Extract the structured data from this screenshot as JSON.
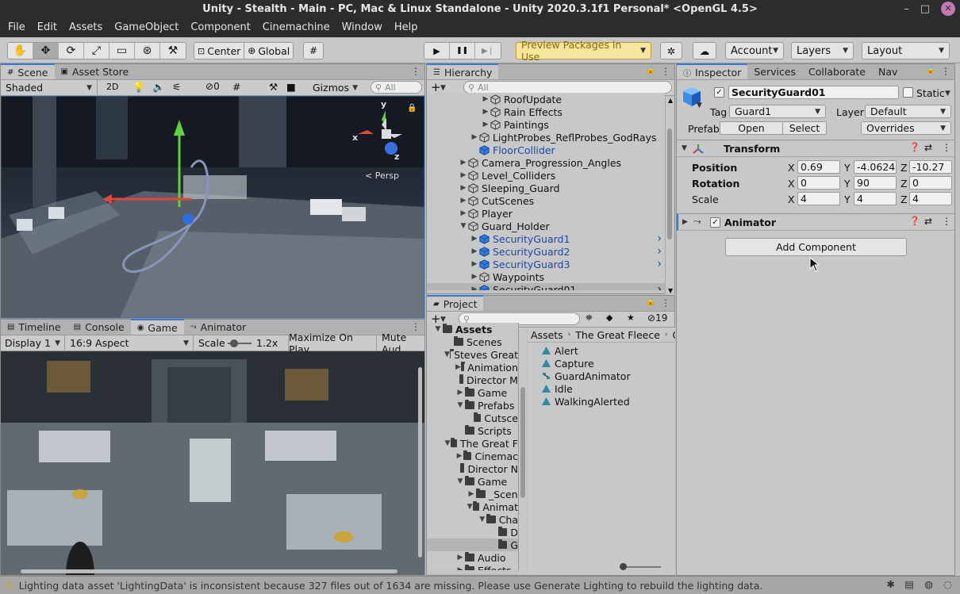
{
  "window": {
    "title": "Unity - Stealth - Main - PC, Mac & Linux Standalone - Unity 2020.3.1f1 Personal* <OpenGL 4.5>",
    "minimize": "–",
    "maximize": "□",
    "close": "✕"
  },
  "menu": [
    "File",
    "Edit",
    "Assets",
    "GameObject",
    "Component",
    "Cinemachine",
    "Window",
    "Help"
  ],
  "toolbar": {
    "tools": [
      "✋",
      "✥",
      "⟳",
      "⤢",
      "▭",
      "⊛",
      "⚒"
    ],
    "center_label": "Center",
    "global_label": "Global",
    "play": "▶",
    "pause": "❚❚",
    "step": "▶❘",
    "preview_packages": "Preview Packages in Use",
    "account_label": "Account",
    "layers_label": "Layers",
    "layout_label": "Layout"
  },
  "scene": {
    "tab_scene": "Scene",
    "tab_asset_store": "Asset Store",
    "shading": "Shaded",
    "mode_2d": "2D",
    "hidden_count": "0",
    "gizmos": "Gizmos",
    "search_placeholder": "All",
    "persp_label": "< Persp",
    "axis_x": "x",
    "axis_y": "y",
    "axis_z": "z"
  },
  "game": {
    "tabs": [
      "Timeline",
      "Console",
      "Game",
      "Animator"
    ],
    "display": "Display 1",
    "aspect": "16:9 Aspect",
    "scale_label": "Scale",
    "scale_value": "1.2x",
    "maximize_on_play": "Maximize On Play",
    "mute_audio": "Mute Aud"
  },
  "hierarchy": {
    "tab": "Hierarchy",
    "search_placeholder": "All",
    "add": "+",
    "rows": [
      {
        "label": "RoofUpdate",
        "indent": 3,
        "arrow": "▶",
        "icon": "gameobject",
        "blue": false,
        "selected": false,
        "chevron": false
      },
      {
        "label": "Rain Effects",
        "indent": 3,
        "arrow": "▶",
        "icon": "gameobject",
        "blue": false,
        "selected": false,
        "chevron": false
      },
      {
        "label": "Paintings",
        "indent": 3,
        "arrow": "▶",
        "icon": "gameobject",
        "blue": false,
        "selected": false,
        "chevron": false
      },
      {
        "label": "LightProbes_ReflProbes_GodRays",
        "indent": 2,
        "arrow": "▶",
        "icon": "gameobject",
        "blue": false,
        "selected": false,
        "chevron": false
      },
      {
        "label": "FloorCollider",
        "indent": 2,
        "arrow": "",
        "icon": "prefab",
        "blue": true,
        "selected": false,
        "chevron": false
      },
      {
        "label": "Camera_Progression_Angles",
        "indent": 1,
        "arrow": "▶",
        "icon": "gameobject",
        "blue": false,
        "selected": false,
        "chevron": false
      },
      {
        "label": "Level_Colliders",
        "indent": 1,
        "arrow": "▶",
        "icon": "gameobject",
        "blue": false,
        "selected": false,
        "chevron": false
      },
      {
        "label": "Sleeping_Guard",
        "indent": 1,
        "arrow": "▶",
        "icon": "gameobject",
        "blue": false,
        "selected": false,
        "chevron": false
      },
      {
        "label": "CutScenes",
        "indent": 1,
        "arrow": "▶",
        "icon": "gameobject",
        "blue": false,
        "selected": false,
        "chevron": false
      },
      {
        "label": "Player",
        "indent": 1,
        "arrow": "▶",
        "icon": "gameobject",
        "blue": false,
        "selected": false,
        "chevron": false
      },
      {
        "label": "Guard_Holder",
        "indent": 1,
        "arrow": "▼",
        "icon": "gameobject",
        "blue": false,
        "selected": false,
        "chevron": false
      },
      {
        "label": "SecurityGuard1",
        "indent": 2,
        "arrow": "▶",
        "icon": "prefab",
        "blue": true,
        "selected": false,
        "chevron": true
      },
      {
        "label": "SecurityGuard2",
        "indent": 2,
        "arrow": "▶",
        "icon": "prefab",
        "blue": true,
        "selected": false,
        "chevron": true
      },
      {
        "label": "SecurityGuard3",
        "indent": 2,
        "arrow": "▶",
        "icon": "prefab",
        "blue": true,
        "selected": false,
        "chevron": true
      },
      {
        "label": "Waypoints",
        "indent": 2,
        "arrow": "▶",
        "icon": "gameobject",
        "blue": false,
        "selected": false,
        "chevron": false
      },
      {
        "label": "SecurityGuard01",
        "indent": 2,
        "arrow": "▶",
        "icon": "prefab",
        "blue": false,
        "selected": true,
        "chevron": true
      }
    ]
  },
  "project": {
    "tab": "Project",
    "add": "+",
    "hidden_count": "19",
    "folders": [
      {
        "label": "Assets",
        "indent": 0,
        "arrow": "▼"
      },
      {
        "label": "Scenes",
        "indent": 1,
        "arrow": ""
      },
      {
        "label": "Steves Great",
        "indent": 1,
        "arrow": "▼"
      },
      {
        "label": "Animation",
        "indent": 2,
        "arrow": "▶"
      },
      {
        "label": "Director M",
        "indent": 2,
        "arrow": ""
      },
      {
        "label": "Game",
        "indent": 2,
        "arrow": "▶"
      },
      {
        "label": "Prefabs",
        "indent": 2,
        "arrow": "▼"
      },
      {
        "label": "Cutsce",
        "indent": 3,
        "arrow": ""
      },
      {
        "label": "Scripts",
        "indent": 2,
        "arrow": ""
      },
      {
        "label": "The Great F",
        "indent": 1,
        "arrow": "▼"
      },
      {
        "label": "Cinemac",
        "indent": 2,
        "arrow": "▶"
      },
      {
        "label": "Director N",
        "indent": 2,
        "arrow": ""
      },
      {
        "label": "Game",
        "indent": 2,
        "arrow": "▼"
      },
      {
        "label": "_Scen",
        "indent": 3,
        "arrow": "▶"
      },
      {
        "label": "Animat",
        "indent": 3,
        "arrow": "▼"
      },
      {
        "label": "Cha",
        "indent": 4,
        "arrow": "▼"
      },
      {
        "label": "D",
        "indent": 5,
        "arrow": ""
      },
      {
        "label": "G",
        "indent": 5,
        "arrow": ""
      },
      {
        "label": "Audio",
        "indent": 2,
        "arrow": "▶"
      },
      {
        "label": "Effects",
        "indent": 2,
        "arrow": "▶"
      }
    ],
    "breadcrumb": [
      "Assets",
      "The Great Fleece",
      "Ga"
    ],
    "assets": [
      "Alert",
      "Capture",
      "GuardAnimator",
      "Idle",
      "WalkingAlerted"
    ]
  },
  "inspector": {
    "tabs": [
      "Inspector",
      "Services",
      "Collaborate",
      "Nav"
    ],
    "object_name": "SecurityGuard01",
    "static_label": "Static",
    "tag_label": "Tag",
    "tag_value": "Guard1",
    "layer_label": "Layer",
    "layer_value": "Default",
    "prefab_label": "Prefab",
    "prefab_open": "Open",
    "prefab_select": "Select",
    "prefab_overrides": "Overrides",
    "transform_label": "Transform",
    "position_label": "Position",
    "rotation_label": "Rotation",
    "scale_label": "Scale",
    "position": {
      "x": "0.69",
      "y": "-4.0624",
      "z": "-10.27"
    },
    "rotation": {
      "x": "0",
      "y": "90",
      "z": "0"
    },
    "scale": {
      "x": "4",
      "y": "4",
      "z": "4"
    },
    "axis_x": "X",
    "axis_y": "Y",
    "axis_z": "Z",
    "animator_label": "Animator",
    "add_component": "Add Component"
  },
  "status": {
    "message": "Lighting data asset 'LightingData' is inconsistent because 327 files out of 1634 are missing.  Please use Generate Lighting to rebuild the lighting data."
  },
  "colors": {
    "accent": "#3a79d8",
    "prefab_blue": "#1d48a6",
    "preview_bg": "#f6e59c"
  }
}
